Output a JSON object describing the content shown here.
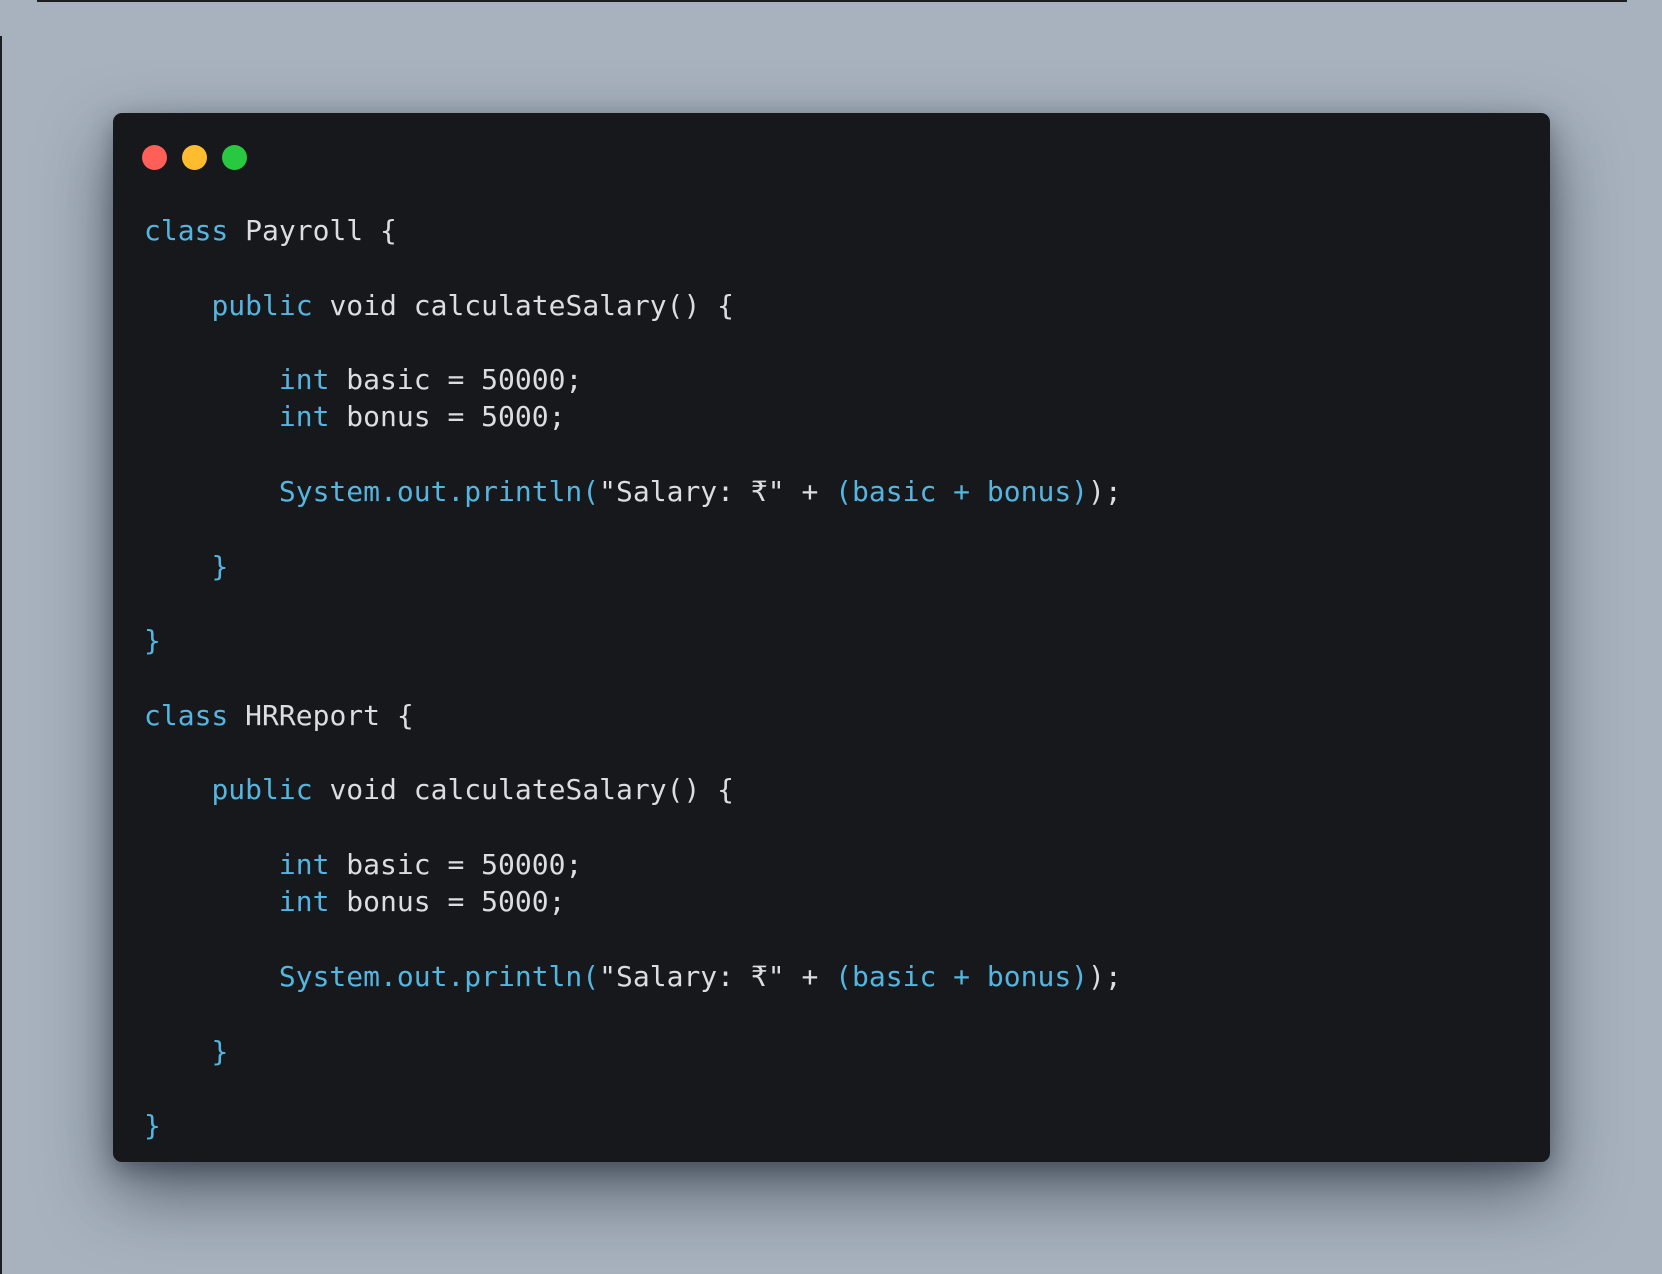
{
  "window_controls": [
    {
      "name": "close",
      "color": "#fe5f57"
    },
    {
      "name": "minimize",
      "color": "#febc2e"
    },
    {
      "name": "maximize",
      "color": "#28c840"
    }
  ],
  "colors": {
    "background": "#a7b2be",
    "window": "#17181b",
    "keyword": "#54b6e0",
    "text": "#dcdde0"
  },
  "code_lines": [
    [
      {
        "t": "class",
        "k": "kw"
      },
      {
        "t": " Payroll {",
        "k": "txt"
      }
    ],
    [],
    [
      {
        "t": "    ",
        "k": "txt"
      },
      {
        "t": "public",
        "k": "kw"
      },
      {
        "t": " void calculateSalary() {",
        "k": "txt"
      }
    ],
    [],
    [
      {
        "t": "        ",
        "k": "txt"
      },
      {
        "t": "int",
        "k": "kw"
      },
      {
        "t": " basic = 50000;",
        "k": "txt"
      }
    ],
    [
      {
        "t": "        ",
        "k": "txt"
      },
      {
        "t": "int",
        "k": "kw"
      },
      {
        "t": " bonus = 5000;",
        "k": "txt"
      }
    ],
    [],
    [
      {
        "t": "        ",
        "k": "txt"
      },
      {
        "t": "System.out.println(",
        "k": "kw"
      },
      {
        "t": "\"Salary: ₹\" + ",
        "k": "txt"
      },
      {
        "t": "(basic + bonus)",
        "k": "kw"
      },
      {
        "t": ");",
        "k": "txt"
      }
    ],
    [],
    [
      {
        "t": "    ",
        "k": "txt"
      },
      {
        "t": "}",
        "k": "kw"
      }
    ],
    [],
    [
      {
        "t": "}",
        "k": "kw"
      }
    ],
    [],
    [
      {
        "t": "class",
        "k": "kw"
      },
      {
        "t": " HRReport {",
        "k": "txt"
      }
    ],
    [],
    [
      {
        "t": "    ",
        "k": "txt"
      },
      {
        "t": "public",
        "k": "kw"
      },
      {
        "t": " void calculateSalary() {",
        "k": "txt"
      }
    ],
    [],
    [
      {
        "t": "        ",
        "k": "txt"
      },
      {
        "t": "int",
        "k": "kw"
      },
      {
        "t": " basic = 50000;",
        "k": "txt"
      }
    ],
    [
      {
        "t": "        ",
        "k": "txt"
      },
      {
        "t": "int",
        "k": "kw"
      },
      {
        "t": " bonus = 5000;",
        "k": "txt"
      }
    ],
    [],
    [
      {
        "t": "        ",
        "k": "txt"
      },
      {
        "t": "System.out.println(",
        "k": "kw"
      },
      {
        "t": "\"Salary: ₹\" + ",
        "k": "txt"
      },
      {
        "t": "(basic + bonus)",
        "k": "kw"
      },
      {
        "t": ");",
        "k": "txt"
      }
    ],
    [],
    [
      {
        "t": "    ",
        "k": "txt"
      },
      {
        "t": "}",
        "k": "kw"
      }
    ],
    [],
    [
      {
        "t": "}",
        "k": "kw"
      }
    ]
  ]
}
